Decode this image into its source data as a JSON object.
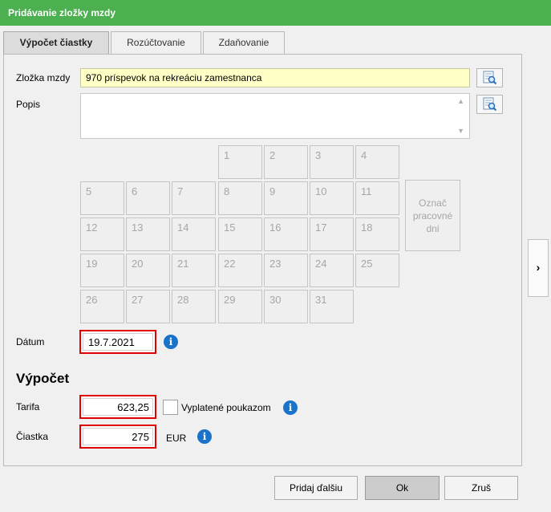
{
  "window": {
    "title": "Pridávanie zložky mzdy"
  },
  "tabs": [
    {
      "label": "Výpočet čiastky",
      "active": true
    },
    {
      "label": "Rozúčtovanie",
      "active": false
    },
    {
      "label": "Zdaňovanie",
      "active": false
    }
  ],
  "form": {
    "component_label": "Zložka mzdy",
    "component_value": "970  príspevok na rekreáciu zamestnanca",
    "description_label": "Popis",
    "description_value": "",
    "date_label": "Dátum",
    "date_value": "19.7.2021"
  },
  "calendar": {
    "days": [
      "1",
      "2",
      "3",
      "4",
      "5",
      "6",
      "7",
      "8",
      "9",
      "10",
      "11",
      "12",
      "13",
      "14",
      "15",
      "16",
      "17",
      "18",
      "19",
      "20",
      "21",
      "22",
      "23",
      "24",
      "25",
      "26",
      "27",
      "28",
      "29",
      "30",
      "31"
    ],
    "mark_working_days_lines": [
      "Označ",
      "pracovné",
      "dni"
    ]
  },
  "calculation": {
    "title": "Výpočet",
    "rate_label": "Tarifa",
    "rate_value": "623,25",
    "voucher_label": "Vyplatené poukazom",
    "voucher_checked": false,
    "amount_label": "Čiastka",
    "amount_value": "275",
    "currency": "EUR"
  },
  "icons": {
    "info": "i",
    "side_arrow": "›",
    "scroll_up": "▲",
    "scroll_down": "▼"
  },
  "buttons": {
    "add_next": "Pridaj ďalšiu",
    "ok": "Ok",
    "cancel": "Zruš"
  },
  "colors": {
    "titlebar": "#4caf50",
    "highlight_border": "#e00000",
    "info_icon": "#1a73c9",
    "component_field": "#ffffc6"
  }
}
